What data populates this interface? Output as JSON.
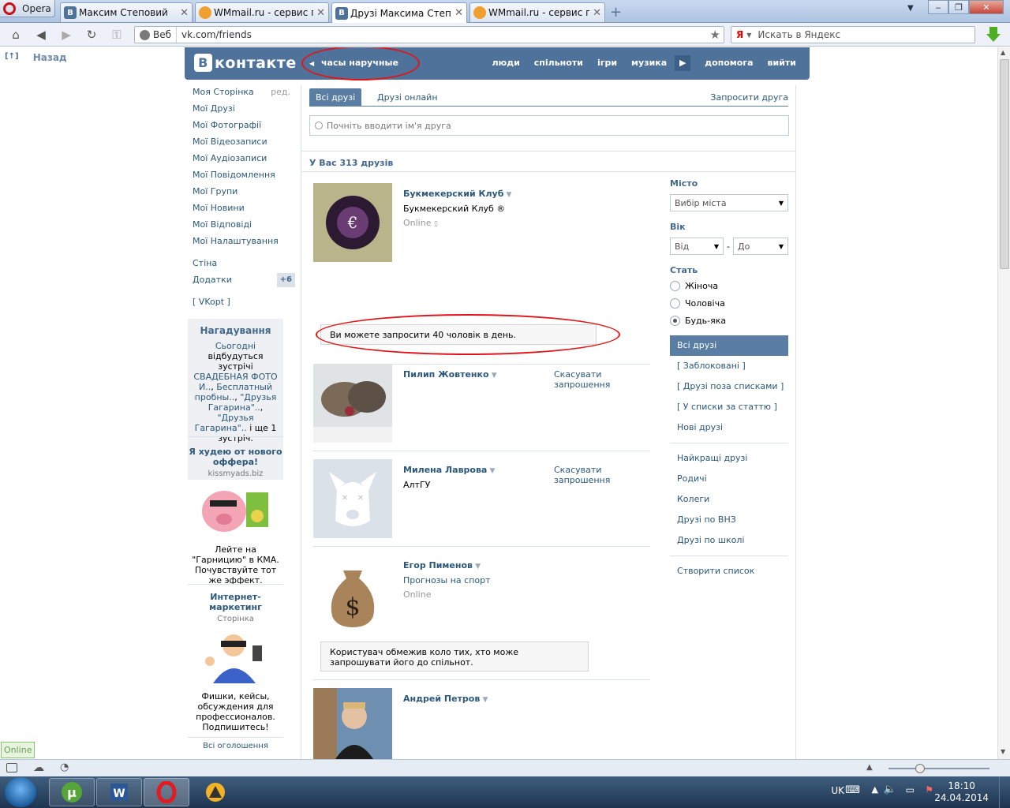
{
  "browser": {
    "menu_label": "Opera",
    "tabs": [
      {
        "title": "Максим Степовий",
        "icon": "vk-favicon",
        "active": false
      },
      {
        "title": "WMmail.ru - сервис п...",
        "icon": "wmmail-favicon",
        "active": false
      },
      {
        "title": "Друзі Максима Степо...",
        "icon": "vk-favicon",
        "active": true
      },
      {
        "title": "WMmail.ru - сервис п...",
        "icon": "wmmail-favicon",
        "active": false
      }
    ],
    "address_label": "Веб",
    "url": "vk.com/friends",
    "search_placeholder": "Искать в Яндекс",
    "search_engine_glyph": "Я",
    "back_label": "Назад",
    "status_online": "Online"
  },
  "vk": {
    "logo_text": "контакте",
    "status_text": "часы наручные",
    "top_menu": [
      "люди",
      "спільноти",
      "ігри",
      "музика",
      "допомога",
      "вийти"
    ],
    "accent": "#4e729a",
    "left_menu": {
      "main": [
        "Моя Сторінка",
        "Мої Друзі",
        "Мої Фотографії",
        "Мої Відеозаписи",
        "Мої Аудіозаписи",
        "Мої Повідомлення",
        "Мої Групи",
        "Мої Новини",
        "Мої Відповіді",
        "Мої Налаштування"
      ],
      "edit_label": "ред.",
      "wall": "Стіна",
      "apps": "Додатки",
      "apps_badge": "+6",
      "vkopt": "[ VKopt ]"
    },
    "reminder": {
      "title": "Нагадування",
      "line1": "Сьогодні",
      "line2": "відбудуться зустрічі",
      "link1": "СВАДЕБНАЯ ФОТО И..",
      "sep1": ",",
      "link2": "Бесплатный пробны..",
      "sep2": ",",
      "link3": "\"Друзья Гагарина\"..",
      "sep3": ",",
      "link4": "\"Друзья Гагарина\"..",
      "tail": " і ще 1 зустріч."
    },
    "ads": [
      {
        "title": "Я худею от нового оффера!",
        "sub": "kissmyads.biz",
        "text": "Лейте на \"Гарницию\" в КМА. Почувствуйте тот же эффект."
      },
      {
        "title": "Интернет-маркетинг",
        "sub": "Сторінка",
        "text": "Фишки, кейсы, обсуждения для профессионалов. Подпишитесь!"
      }
    ],
    "all_ads": "Всі оголошення",
    "tabs": {
      "all": "Всі друзі",
      "online": "Друзі онлайн",
      "invite": "Запросити друга"
    },
    "search_placeholder": "Почніть вводити ім'я друга",
    "summary": "У Вас 313 друзів",
    "friends": [
      {
        "name": "Букмекерский Клуб",
        "sub": "Букмекерский Клуб ®",
        "status": "Online"
      },
      {
        "name": "Пилип Жовтенко",
        "action": "Скасувати запрошення"
      },
      {
        "name": "Милена Лаврова",
        "sub": "АлтГУ",
        "action": "Скасувати запрошення"
      },
      {
        "name": "Егор Пименов",
        "sub": "Прогнозы на спорт",
        "status": "Online"
      },
      {
        "name": "Андрей Петров"
      }
    ],
    "notice_invite_limit": "Ви можете запросити 40 чоловік в день.",
    "notice_restricted": "Користувач обмежив коло тих, хто може запрошувати його до спільнот.",
    "filters": {
      "city_label": "Місто",
      "city_value": "Вибір міста",
      "age_label": "Вік",
      "age_from": "Від",
      "age_dash": "-",
      "age_to": "До",
      "sex_label": "Стать",
      "sex_options": [
        "Жіноча",
        "Чоловіча",
        "Будь-яка"
      ],
      "sex_selected": "Будь-яка",
      "lists": [
        "Всі друзі",
        "[ Заблоковані ]",
        "[ Друзі поза списками ]",
        "[ У списки за статтю ]",
        "Нові друзі"
      ],
      "lists2": [
        "Найкращі друзі",
        "Родичі",
        "Колеги",
        "Друзі по ВНЗ",
        "Друзі по школі"
      ],
      "create": "Створити список"
    }
  },
  "taskbar": {
    "lang": "UK",
    "time": "18:10",
    "date": "24.04.2014"
  }
}
